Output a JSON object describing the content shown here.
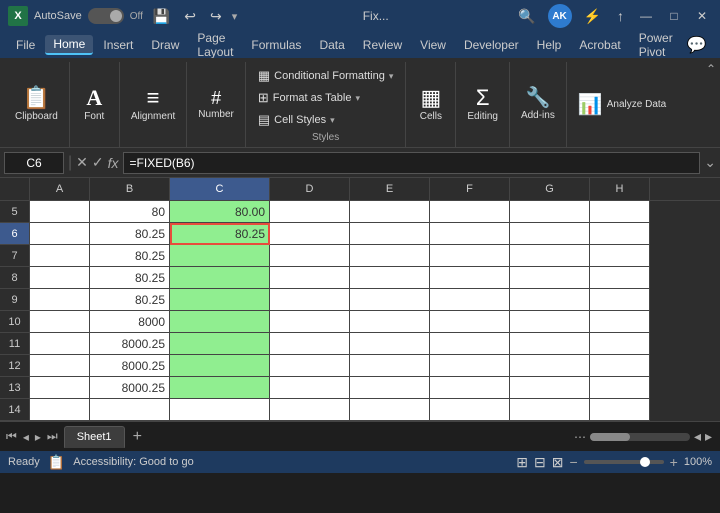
{
  "titlebar": {
    "app_icon": "X",
    "autosave_label": "AutoSave",
    "toggle_state": "Off",
    "save_icon": "💾",
    "undo_icon": "↩",
    "redo_icon": "↪",
    "file_name": "Fix...",
    "search_icon": "🔍",
    "avatar_initials": "AK",
    "minimize": "—",
    "maximize": "□",
    "close": "✕",
    "more_icon": "⚡",
    "share_icon": "↑"
  },
  "menu": {
    "items": [
      "File",
      "Home",
      "Insert",
      "Draw",
      "Page Layout",
      "Formulas",
      "Data",
      "Review",
      "View",
      "Developer",
      "Help",
      "Acrobat",
      "Power Pivot"
    ],
    "active": "Home"
  },
  "ribbon": {
    "groups": [
      {
        "name": "Clipboard",
        "label": "Clipboard",
        "icon": "📋"
      },
      {
        "name": "Font",
        "label": "Font",
        "icon": "A"
      },
      {
        "name": "Alignment",
        "label": "Alignment",
        "icon": "≡"
      },
      {
        "name": "Number",
        "label": "Number",
        "icon": "#"
      }
    ],
    "styles": {
      "label": "Styles",
      "conditional_formatting": "Conditional Formatting",
      "format_as_table": "Format as Table",
      "cell_styles": "Cell Styles"
    },
    "cells": {
      "label": "Cells",
      "icon": "▦"
    },
    "editing": {
      "label": "Editing",
      "icon": "Σ"
    },
    "addins": {
      "label": "Add-ins",
      "icon": "🔧"
    },
    "analyze": {
      "label": "Analyze Data",
      "icon": "📊"
    }
  },
  "formulabar": {
    "cell_ref": "C6",
    "formula": "=FIXED(B6)",
    "check_icon": "✓",
    "cross_icon": "✕",
    "fx_label": "fx"
  },
  "columns": {
    "headers": [
      "",
      "A",
      "B",
      "C",
      "D",
      "E",
      "F",
      "G",
      "H"
    ]
  },
  "rows": [
    {
      "row_num": "5",
      "cells": [
        {
          "col": "A",
          "value": "",
          "style": ""
        },
        {
          "col": "B",
          "value": "80",
          "style": ""
        },
        {
          "col": "C",
          "value": "80.00",
          "style": "green"
        },
        {
          "col": "D",
          "value": "",
          "style": ""
        },
        {
          "col": "E",
          "value": "",
          "style": ""
        },
        {
          "col": "F",
          "value": "",
          "style": ""
        },
        {
          "col": "G",
          "value": "",
          "style": ""
        },
        {
          "col": "H",
          "value": "",
          "style": ""
        }
      ]
    },
    {
      "row_num": "6",
      "cells": [
        {
          "col": "A",
          "value": "",
          "style": ""
        },
        {
          "col": "B",
          "value": "80.25",
          "style": ""
        },
        {
          "col": "C",
          "value": "80.25",
          "style": "green selected"
        },
        {
          "col": "D",
          "value": "",
          "style": ""
        },
        {
          "col": "E",
          "value": "",
          "style": ""
        },
        {
          "col": "F",
          "value": "",
          "style": ""
        },
        {
          "col": "G",
          "value": "",
          "style": ""
        },
        {
          "col": "H",
          "value": "",
          "style": ""
        }
      ]
    },
    {
      "row_num": "7",
      "cells": [
        {
          "col": "A",
          "value": "",
          "style": ""
        },
        {
          "col": "B",
          "value": "80.25",
          "style": ""
        },
        {
          "col": "C",
          "value": "",
          "style": "green"
        },
        {
          "col": "D",
          "value": "",
          "style": ""
        },
        {
          "col": "E",
          "value": "",
          "style": ""
        },
        {
          "col": "F",
          "value": "",
          "style": ""
        },
        {
          "col": "G",
          "value": "",
          "style": ""
        },
        {
          "col": "H",
          "value": "",
          "style": ""
        }
      ]
    },
    {
      "row_num": "8",
      "cells": [
        {
          "col": "A",
          "value": "",
          "style": ""
        },
        {
          "col": "B",
          "value": "80.25",
          "style": ""
        },
        {
          "col": "C",
          "value": "",
          "style": "green"
        },
        {
          "col": "D",
          "value": "",
          "style": ""
        },
        {
          "col": "E",
          "value": "",
          "style": ""
        },
        {
          "col": "F",
          "value": "",
          "style": ""
        },
        {
          "col": "G",
          "value": "",
          "style": ""
        },
        {
          "col": "H",
          "value": "",
          "style": ""
        }
      ]
    },
    {
      "row_num": "9",
      "cells": [
        {
          "col": "A",
          "value": "",
          "style": ""
        },
        {
          "col": "B",
          "value": "80.25",
          "style": ""
        },
        {
          "col": "C",
          "value": "",
          "style": "green"
        },
        {
          "col": "D",
          "value": "",
          "style": ""
        },
        {
          "col": "E",
          "value": "",
          "style": ""
        },
        {
          "col": "F",
          "value": "",
          "style": ""
        },
        {
          "col": "G",
          "value": "",
          "style": ""
        },
        {
          "col": "H",
          "value": "",
          "style": ""
        }
      ]
    },
    {
      "row_num": "10",
      "cells": [
        {
          "col": "A",
          "value": "",
          "style": ""
        },
        {
          "col": "B",
          "value": "8000",
          "style": ""
        },
        {
          "col": "C",
          "value": "",
          "style": "green"
        },
        {
          "col": "D",
          "value": "",
          "style": ""
        },
        {
          "col": "E",
          "value": "",
          "style": ""
        },
        {
          "col": "F",
          "value": "",
          "style": ""
        },
        {
          "col": "G",
          "value": "",
          "style": ""
        },
        {
          "col": "H",
          "value": "",
          "style": ""
        }
      ]
    },
    {
      "row_num": "11",
      "cells": [
        {
          "col": "A",
          "value": "",
          "style": ""
        },
        {
          "col": "B",
          "value": "8000.25",
          "style": ""
        },
        {
          "col": "C",
          "value": "",
          "style": "green"
        },
        {
          "col": "D",
          "value": "",
          "style": ""
        },
        {
          "col": "E",
          "value": "",
          "style": ""
        },
        {
          "col": "F",
          "value": "",
          "style": ""
        },
        {
          "col": "G",
          "value": "",
          "style": ""
        },
        {
          "col": "H",
          "value": "",
          "style": ""
        }
      ]
    },
    {
      "row_num": "12",
      "cells": [
        {
          "col": "A",
          "value": "",
          "style": ""
        },
        {
          "col": "B",
          "value": "8000.25",
          "style": ""
        },
        {
          "col": "C",
          "value": "",
          "style": "green"
        },
        {
          "col": "D",
          "value": "",
          "style": ""
        },
        {
          "col": "E",
          "value": "",
          "style": ""
        },
        {
          "col": "F",
          "value": "",
          "style": ""
        },
        {
          "col": "G",
          "value": "",
          "style": ""
        },
        {
          "col": "H",
          "value": "",
          "style": ""
        }
      ]
    },
    {
      "row_num": "13",
      "cells": [
        {
          "col": "A",
          "value": "",
          "style": ""
        },
        {
          "col": "B",
          "value": "8000.25",
          "style": ""
        },
        {
          "col": "C",
          "value": "",
          "style": "green"
        },
        {
          "col": "D",
          "value": "",
          "style": ""
        },
        {
          "col": "E",
          "value": "",
          "style": ""
        },
        {
          "col": "F",
          "value": "",
          "style": ""
        },
        {
          "col": "G",
          "value": "",
          "style": ""
        },
        {
          "col": "H",
          "value": "",
          "style": ""
        }
      ]
    },
    {
      "row_num": "14",
      "cells": [
        {
          "col": "A",
          "value": "",
          "style": ""
        },
        {
          "col": "B",
          "value": "",
          "style": ""
        },
        {
          "col": "C",
          "value": "",
          "style": ""
        },
        {
          "col": "D",
          "value": "",
          "style": ""
        },
        {
          "col": "E",
          "value": "",
          "style": ""
        },
        {
          "col": "F",
          "value": "",
          "style": ""
        },
        {
          "col": "G",
          "value": "",
          "style": ""
        },
        {
          "col": "H",
          "value": "",
          "style": ""
        }
      ]
    }
  ],
  "sheets": {
    "tabs": [
      "Sheet1"
    ],
    "active": "Sheet1"
  },
  "statusbar": {
    "ready": "Ready",
    "accessibility": "Accessibility: Good to go",
    "zoom": "100%"
  }
}
